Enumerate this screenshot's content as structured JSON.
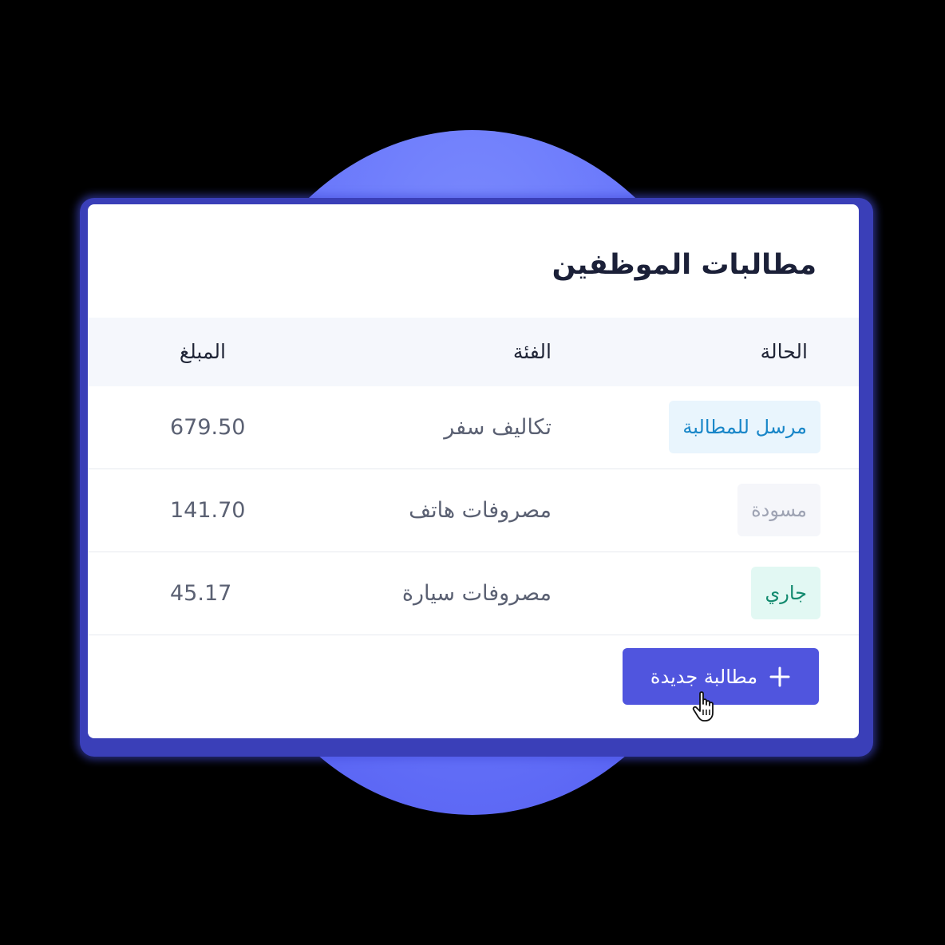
{
  "colors": {
    "primary": "#5055de",
    "circle": "#6a78fb",
    "badge_sent": "#1886c8",
    "badge_draft": "#9ea3b3",
    "badge_progress": "#128a6e"
  },
  "card": {
    "title": "مطالبات الموظفين"
  },
  "table": {
    "headers": {
      "status": "الحالة",
      "category": "الفئة",
      "amount": "المبلغ"
    },
    "rows": [
      {
        "status": "مرسل للمطالبة",
        "category": "تكاليف سفر",
        "amount": "679.50"
      },
      {
        "status": "مسودة",
        "category": "مصروفات هاتف",
        "amount": "141.70"
      },
      {
        "status": "جاري",
        "category": "مصروفات سيارة",
        "amount": "45.17"
      }
    ]
  },
  "actions": {
    "new_claim_label": "مطالبة جديدة",
    "new_claim_icon": "plus-icon",
    "cursor_icon": "hand-pointer-icon"
  }
}
